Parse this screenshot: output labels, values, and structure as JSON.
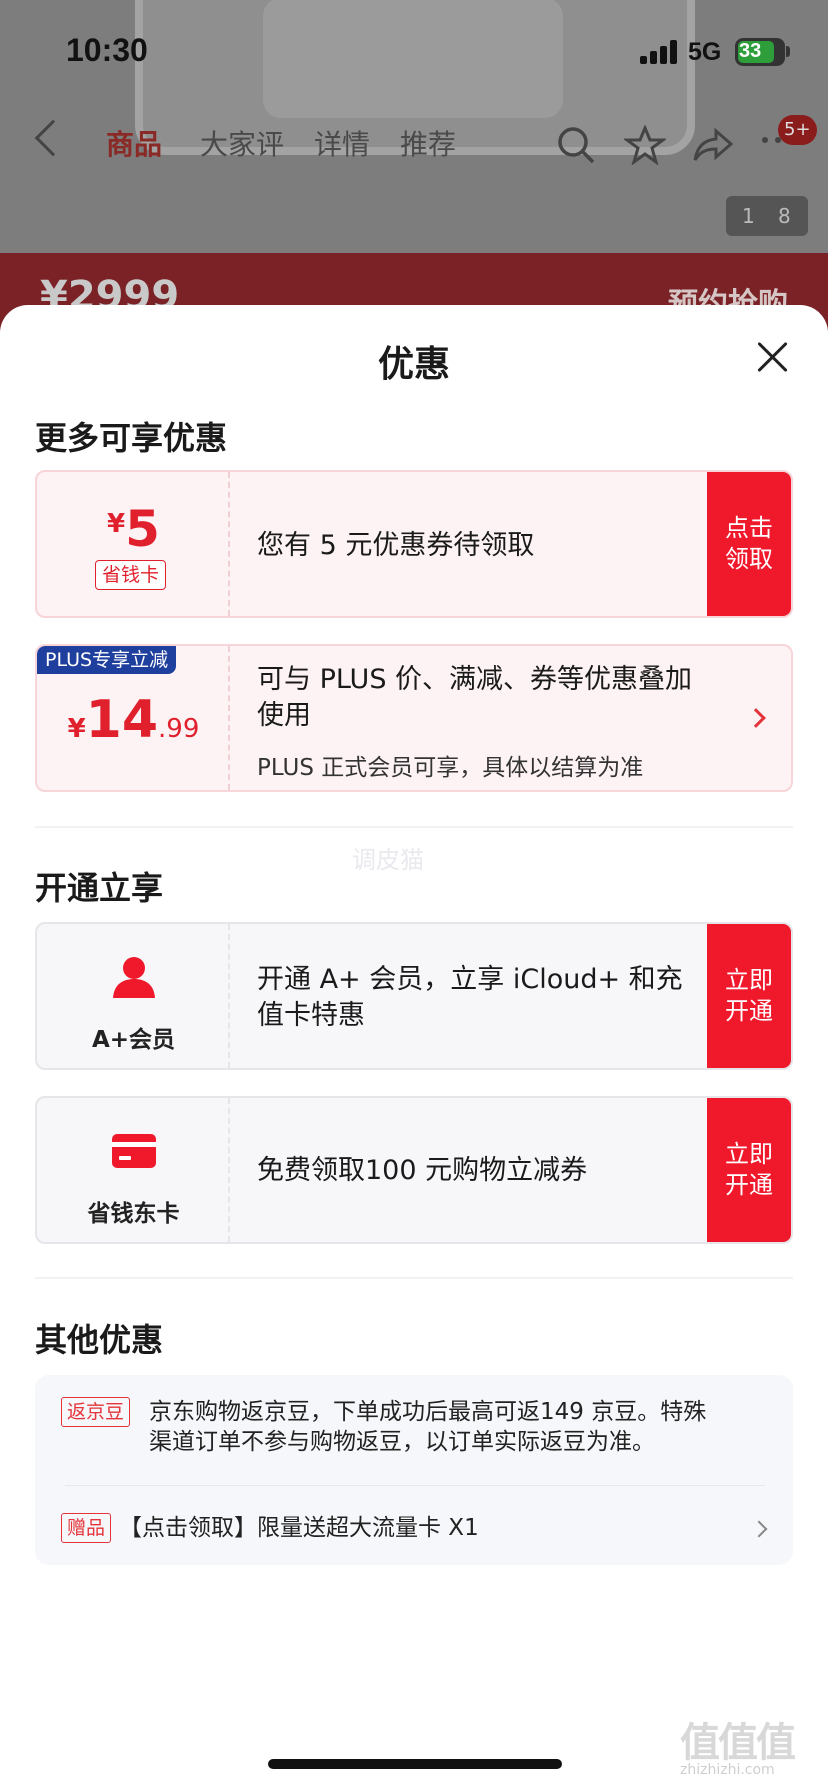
{
  "status_bar": {
    "time": "10:30",
    "network": "5G",
    "battery": "33"
  },
  "nav": {
    "tabs": [
      "商品",
      "大家评",
      "详情",
      "推荐"
    ],
    "badge": "5+",
    "page_current": "1",
    "page_total": "8"
  },
  "background": {
    "price": "¥2999",
    "reserve": "预约抢购"
  },
  "sheet": {
    "title": "优惠",
    "sections": {
      "more": "更多可享优惠",
      "open": "开通立享",
      "other": "其他优惠"
    },
    "coupon": {
      "currency": "¥",
      "amount": "5",
      "tag": "省钱卡",
      "text": "您有 5 元优惠券待领取",
      "action_line1": "点击",
      "action_line2": "领取"
    },
    "plus": {
      "label": "PLUS专享立减",
      "currency": "¥",
      "price_int": "14",
      "price_dec": ".99",
      "text_line1": "可与 PLUS 价、满减、券等优惠叠加",
      "text_line2": "使用",
      "sub": "PLUS 正式会员可享，具体以结算为准"
    },
    "aplus": {
      "label": "A+会员",
      "text_line1": "开通 A+ 会员，立享 iCloud+ 和充",
      "text_line2": "值卡特惠",
      "action_line1": "立即",
      "action_line2": "开通"
    },
    "dongka": {
      "label": "省钱东卡",
      "text": "免费领取100 元购物立减券",
      "action_line1": "立即",
      "action_line2": "开通"
    },
    "other": {
      "jingdou_tag": "返京豆",
      "jingdou_line1": "京东购物返京豆，下单成功后最高可返149 京豆。特殊",
      "jingdou_line2": "渠道订单不参与购物返豆，以订单实际返豆为准。",
      "gift_tag": "赠品",
      "gift_text": "【点击领取】限量送超大流量卡 X1"
    },
    "watermark": "调皮猫"
  },
  "site": {
    "mark": "值值值",
    "url": "zhizhizhi.com"
  },
  "colors": {
    "accent": "#f0192c",
    "plus_blue": "#1f3f9e"
  }
}
